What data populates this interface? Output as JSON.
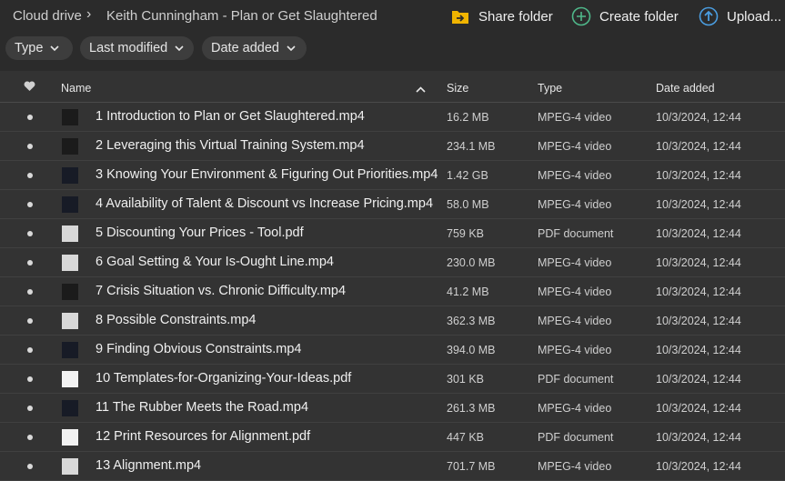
{
  "breadcrumb": {
    "root": "Cloud drive",
    "separator": "›",
    "folder": "Keith Cunningham - Plan or Get Slaughtered"
  },
  "actions": {
    "share": {
      "label": "Share folder",
      "icon": "share-folder-icon",
      "color": "#f0b400"
    },
    "create": {
      "label": "Create folder",
      "icon": "plus-circle-icon",
      "color": "#4fb88a"
    },
    "upload": {
      "label": "Upload...",
      "icon": "upload-icon",
      "color": "#4a9de0"
    }
  },
  "filters": [
    {
      "label": "Type"
    },
    {
      "label": "Last modified"
    },
    {
      "label": "Date added"
    }
  ],
  "columns": {
    "name": "Name",
    "size": "Size",
    "type": "Type",
    "date": "Date added"
  },
  "files": [
    {
      "name": "1 Introduction to Plan or Get Slaughtered.mp4",
      "size": "16.2 MB",
      "type": "MPEG-4 video",
      "date": "10/3/2024, 12:44",
      "thumb": "video"
    },
    {
      "name": "2 Leveraging this Virtual Training System.mp4",
      "size": "234.1 MB",
      "type": "MPEG-4 video",
      "date": "10/3/2024, 12:44",
      "thumb": "video"
    },
    {
      "name": "3 Knowing Your Environment & Figuring Out Priorities.mp4",
      "size": "1.42 GB",
      "type": "MPEG-4 video",
      "date": "10/3/2024, 12:44",
      "thumb": "video-dark"
    },
    {
      "name": "4 Availability of Talent & Discount vs Increase Pricing.mp4",
      "size": "58.0 MB",
      "type": "MPEG-4 video",
      "date": "10/3/2024, 12:44",
      "thumb": "video-dark"
    },
    {
      "name": "5 Discounting Your Prices - Tool.pdf",
      "size": "759 KB",
      "type": "PDF document",
      "date": "10/3/2024, 12:44",
      "thumb": "doc"
    },
    {
      "name": "6 Goal Setting & Your Is-Ought Line.mp4",
      "size": "230.0 MB",
      "type": "MPEG-4 video",
      "date": "10/3/2024, 12:44",
      "thumb": "doc"
    },
    {
      "name": "7 Crisis Situation vs. Chronic Difficulty.mp4",
      "size": "41.2 MB",
      "type": "MPEG-4 video",
      "date": "10/3/2024, 12:44",
      "thumb": "video"
    },
    {
      "name": "8 Possible Constraints.mp4",
      "size": "362.3 MB",
      "type": "MPEG-4 video",
      "date": "10/3/2024, 12:44",
      "thumb": "doc"
    },
    {
      "name": "9 Finding Obvious Constraints.mp4",
      "size": "394.0 MB",
      "type": "MPEG-4 video",
      "date": "10/3/2024, 12:44",
      "thumb": "video-dark"
    },
    {
      "name": "10 Templates-for-Organizing-Your-Ideas.pdf",
      "size": "301 KB",
      "type": "PDF document",
      "date": "10/3/2024, 12:44",
      "thumb": "pdf"
    },
    {
      "name": "11 The Rubber Meets the Road.mp4",
      "size": "261.3 MB",
      "type": "MPEG-4 video",
      "date": "10/3/2024, 12:44",
      "thumb": "video-dark"
    },
    {
      "name": "12 Print Resources for Alignment.pdf",
      "size": "447 KB",
      "type": "PDF document",
      "date": "10/3/2024, 12:44",
      "thumb": "pdf"
    },
    {
      "name": "13 Alignment.mp4",
      "size": "701.7 MB",
      "type": "MPEG-4 video",
      "date": "10/3/2024, 12:44",
      "thumb": "doc"
    }
  ]
}
